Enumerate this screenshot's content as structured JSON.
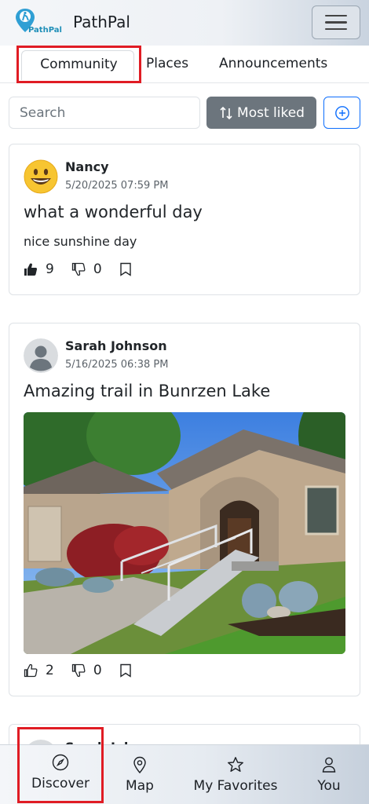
{
  "app": {
    "name": "PathPal",
    "logo_text": "PathPal"
  },
  "tabs": [
    {
      "label": "Community",
      "active": true
    },
    {
      "label": "Places",
      "active": false
    },
    {
      "label": "Announcements",
      "active": false
    }
  ],
  "search": {
    "placeholder": "Search",
    "value": ""
  },
  "sort_button": {
    "label": "Most liked",
    "icon": "sort-arrows-icon"
  },
  "add_button": {
    "icon": "plus-circle-icon"
  },
  "posts": [
    {
      "author": "Nancy",
      "date": "5/20/2025 07:59 PM",
      "avatar": "smiley-emoji",
      "title": "what a wonderful day",
      "body": "nice sunshine day",
      "likes": "9",
      "dislikes": "0",
      "liked": true
    },
    {
      "author": "Sarah Johnson",
      "date": "5/16/2025 06:38 PM",
      "avatar": "default-user",
      "title": "Amazing trail in Bunrzen Lake",
      "image": "house-with-accessible-ramp",
      "likes": "2",
      "dislikes": "0",
      "liked": false
    },
    {
      "author": "Sarah Johnson",
      "avatar": "default-user"
    }
  ],
  "bottom_nav": [
    {
      "label": "Discover",
      "icon": "compass-icon",
      "active": true
    },
    {
      "label": "Map",
      "icon": "map-pin-icon"
    },
    {
      "label": "My Favorites",
      "icon": "star-icon"
    },
    {
      "label": "You",
      "icon": "person-icon"
    }
  ],
  "colors": {
    "accent": "#0d6efd",
    "sort_bg": "#6c757d",
    "highlight": "#e01c24"
  }
}
